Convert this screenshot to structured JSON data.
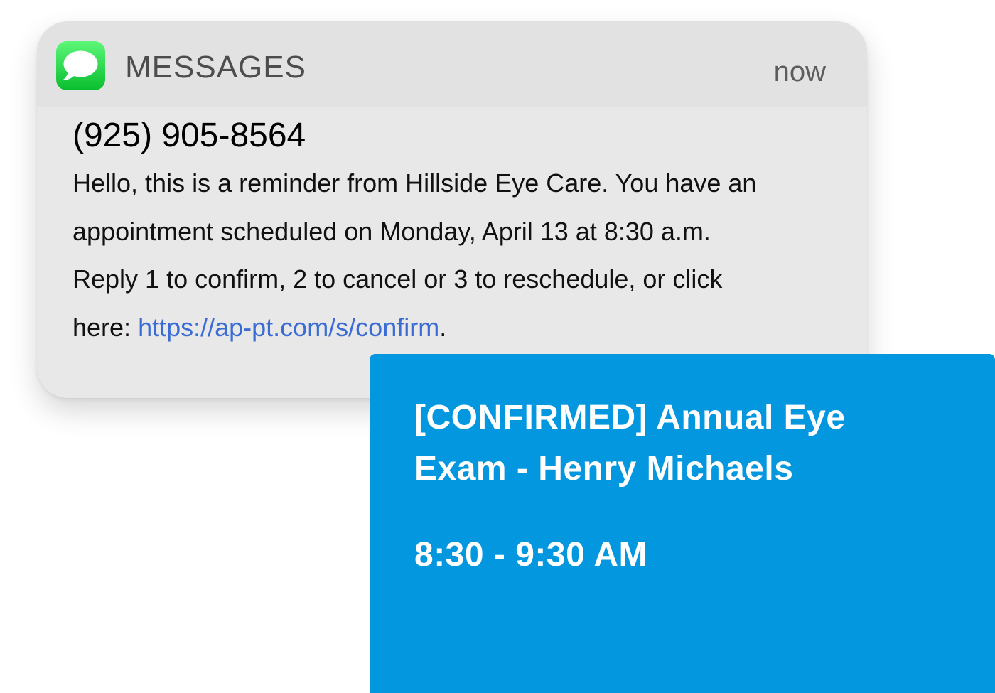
{
  "notification": {
    "app_icon": "messages-icon",
    "app_name": "MESSAGES",
    "time": "now",
    "sender": "(925) 905-8564",
    "message_lines": [
      "Hello, this is a reminder from Hillside Eye Care. You have an",
      "appointment scheduled on Monday, April 13 at 8:30 a.m.",
      "Reply 1 to confirm, 2 to cancel or 3 to reschedule, or click"
    ],
    "message_last_prefix": "here: ",
    "link_text": "https://ap-pt.com/s/confirm",
    "message_last_suffix": "."
  },
  "event": {
    "title": "[CONFIRMED] Annual Eye Exam - Henry Michaels",
    "time": "8:30 - 9:30 AM"
  },
  "colors": {
    "event_card": "#0397e0",
    "link": "#3a6cd4",
    "app_icon_green": "#2fd84e"
  }
}
